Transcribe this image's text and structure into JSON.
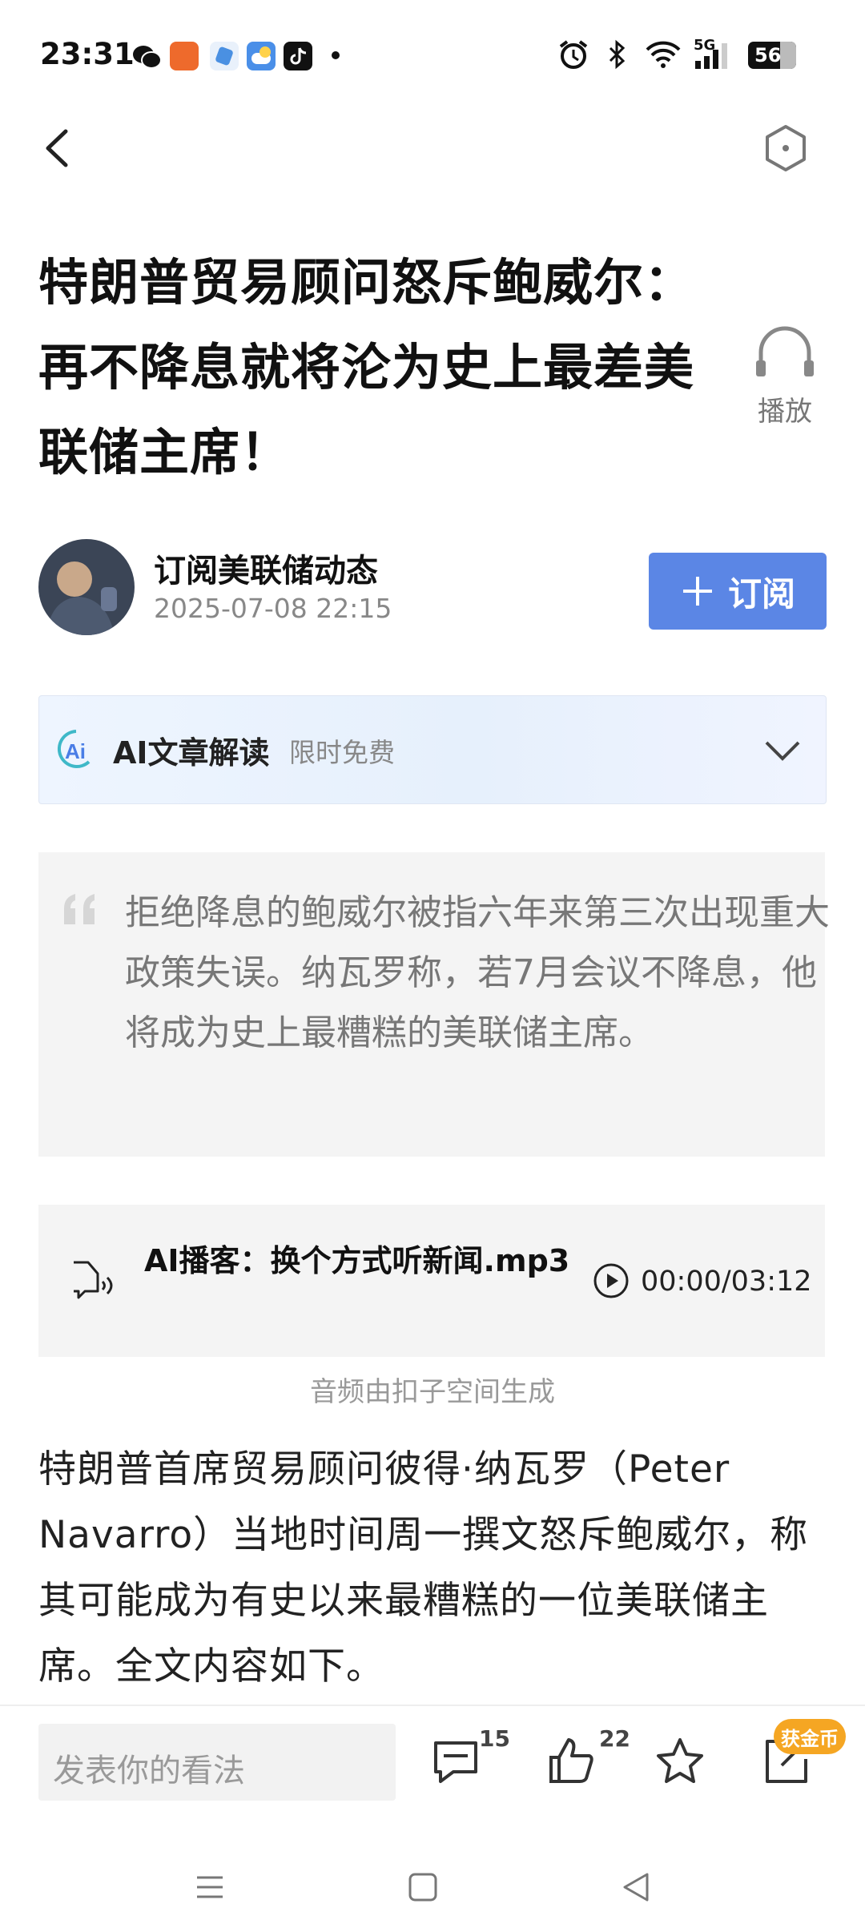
{
  "status_bar": {
    "time": "23:31",
    "battery": "56",
    "network": "5G"
  },
  "header": {
    "back_icon": "chevron-left-icon",
    "action_icon": "hexagon-icon"
  },
  "article": {
    "title": "特朗普贸易顾问怒斥鲍威尔：再不降息就将沦为史上最差美联储主席！",
    "play_label": "播放",
    "author": "订阅美联储动态",
    "datetime": "2025-07-08 22:15",
    "subscribe_label": "订阅",
    "ai_title": "AI文章解读",
    "ai_tag": "限时免费",
    "summary": "拒绝降息的鲍威尔被指六年来第三次出现重大政策失误。纳瓦罗称，若7月会议不降息，他将成为史上最糟糕的美联储主席。",
    "audio_title": "AI播客：换个方式听新闻.mp3",
    "audio_time": "00:00/03:12",
    "audio_caption": "音频由扣子空间生成",
    "body": "特朗普首席贸易顾问彼得·纳瓦罗（Peter Navarro）当地时间周一撰文怒斥鲍威尔，称其可能成为有史以来最糟糕的一位美联储主席。全文内容如下。"
  },
  "bottom_bar": {
    "comment_placeholder": "发表你的看法",
    "comment_count": "15",
    "like_count": "22",
    "coin_badge": "获金币"
  },
  "colors": {
    "accent": "#5b86e5",
    "coin": "#f5a623"
  }
}
